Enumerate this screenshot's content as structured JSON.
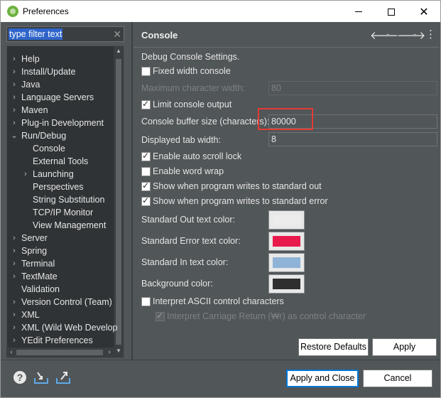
{
  "window": {
    "title": "Preferences",
    "minimize": "—",
    "maximize": "□",
    "close": "✕"
  },
  "filter": {
    "text": "type filter text",
    "clear": "✕"
  },
  "tree": [
    {
      "label": "Help",
      "chev": "›",
      "level": 0
    },
    {
      "label": "Install/Update",
      "chev": "›",
      "level": 0
    },
    {
      "label": "Java",
      "chev": "›",
      "level": 0
    },
    {
      "label": "Language Servers",
      "chev": "›",
      "level": 0
    },
    {
      "label": "Maven",
      "chev": "›",
      "level": 0
    },
    {
      "label": "Plug-in Development",
      "chev": "›",
      "level": 0
    },
    {
      "label": "Run/Debug",
      "chev": "⌄",
      "level": 0
    },
    {
      "label": "Console",
      "chev": "",
      "level": 1
    },
    {
      "label": "External Tools",
      "chev": "",
      "level": 1
    },
    {
      "label": "Launching",
      "chev": "›",
      "level": 1
    },
    {
      "label": "Perspectives",
      "chev": "",
      "level": 1
    },
    {
      "label": "String Substitution",
      "chev": "",
      "level": 1
    },
    {
      "label": "TCP/IP Monitor",
      "chev": "",
      "level": 1
    },
    {
      "label": "View Management",
      "chev": "",
      "level": 1
    },
    {
      "label": "Server",
      "chev": "›",
      "level": 0
    },
    {
      "label": "Spring",
      "chev": "›",
      "level": 0
    },
    {
      "label": "Terminal",
      "chev": "›",
      "level": 0
    },
    {
      "label": "TextMate",
      "chev": "›",
      "level": 0
    },
    {
      "label": "Validation",
      "chev": "",
      "level": 0
    },
    {
      "label": "Version Control (Team)",
      "chev": "›",
      "level": 0
    },
    {
      "label": "XML",
      "chev": "›",
      "level": 0
    },
    {
      "label": "XML (Wild Web Develop",
      "chev": "›",
      "level": 0
    },
    {
      "label": "YEdit Preferences",
      "chev": "›",
      "level": 0
    }
  ],
  "header": {
    "title": "Console",
    "back": "🡐",
    "forward": "🡒",
    "dropdown": "▾",
    "menu": "⋮"
  },
  "form": {
    "intro": "Debug Console Settings.",
    "fixed_width": {
      "label": "Fixed width console",
      "checked": false
    },
    "max_width": {
      "label": "Maximum character width:",
      "value": "80"
    },
    "limit_output": {
      "label": "Limit console output",
      "checked": true
    },
    "buffer_size": {
      "label": "Console buffer size (characters):",
      "value": "80000"
    },
    "tab_width": {
      "label": "Displayed tab width:",
      "value": "8"
    },
    "auto_scroll": {
      "label": "Enable auto scroll lock",
      "checked": true
    },
    "word_wrap": {
      "label": "Enable word wrap",
      "checked": false
    },
    "show_stdout": {
      "label": "Show when program writes to standard out",
      "checked": true
    },
    "show_stderr": {
      "label": "Show when program writes to standard error",
      "checked": true
    },
    "std_out_color": {
      "label": "Standard Out text color:",
      "color": "#ececec"
    },
    "std_err_color": {
      "label": "Standard Error text color:",
      "color": "#e8194b"
    },
    "std_in_color": {
      "label": "Standard In text color:",
      "color": "#8eb3d6"
    },
    "bg_color": {
      "label": "Background color:",
      "color": "#2f2f2f"
    },
    "ascii": {
      "label": "Interpret ASCII control characters",
      "checked": false
    },
    "carriage_return": {
      "label": "Interpret Carriage Return (₩r) as control character",
      "checked": true
    }
  },
  "buttons": {
    "restore_defaults": "Restore Defaults",
    "apply": "Apply",
    "apply_close": "Apply and Close",
    "cancel": "Cancel"
  },
  "footer_icons": [
    "help-icon",
    "import-icon",
    "export-icon"
  ],
  "colors": {
    "panel": "#515658",
    "tree_bg": "#2f3335",
    "selection": "#2f65ca",
    "highlight": "#e53935",
    "primary_border": "#0078d7"
  }
}
